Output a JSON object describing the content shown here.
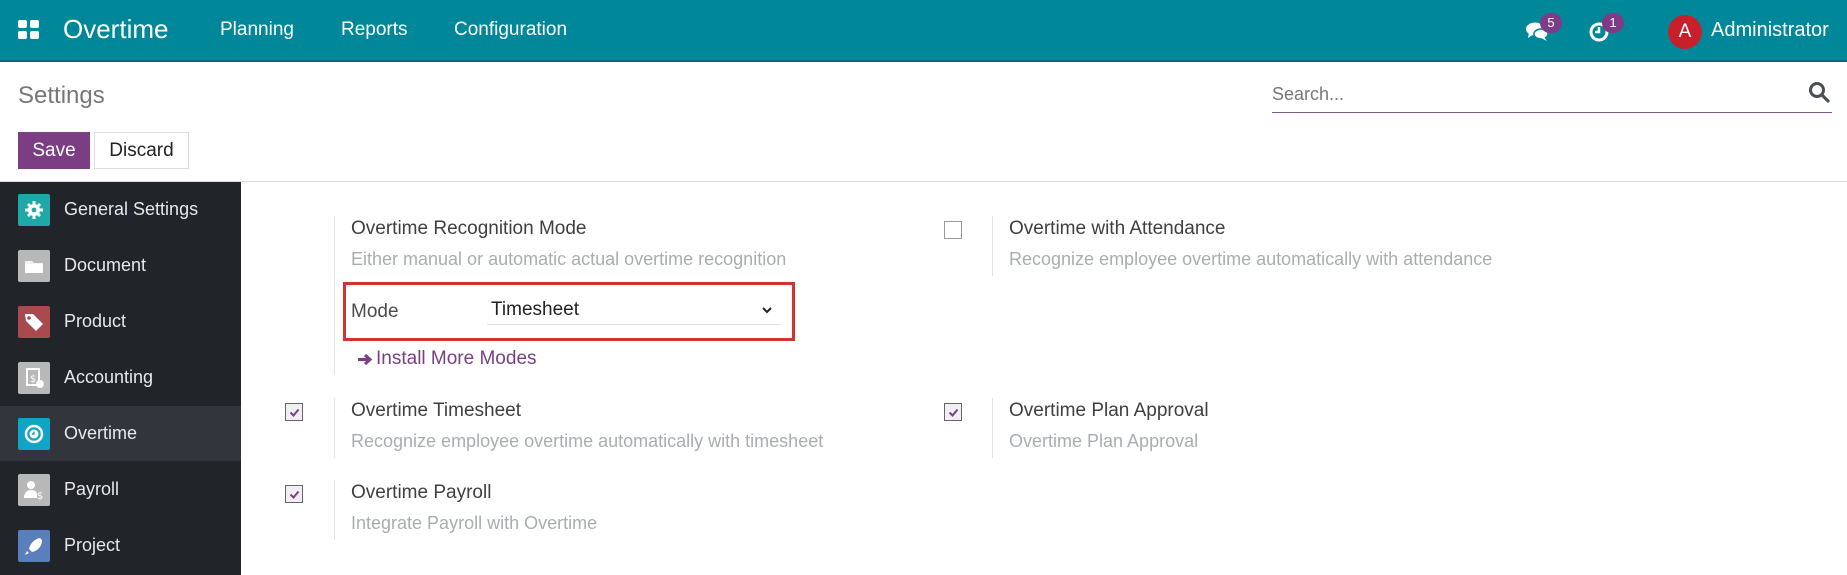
{
  "navbar": {
    "app_name": "Overtime",
    "menu": [
      {
        "label": "Planning"
      },
      {
        "label": "Reports"
      },
      {
        "label": "Configuration"
      }
    ],
    "messages_icon": "chat-bubbles-icon",
    "messages_count": "5",
    "activities_icon": "clock-icon",
    "activities_count": "1",
    "avatar_initial": "A",
    "user_name": "Administrator",
    "colors": {
      "bar": "#00879a",
      "badge": "#7c3c86",
      "avatar": "#c8202b"
    }
  },
  "control_panel": {
    "title": "Settings",
    "search_placeholder": "Search...",
    "search_value": "",
    "save_label": "Save",
    "discard_label": "Discard",
    "save_color": "#7c3e83"
  },
  "sidebar": {
    "items": [
      {
        "label": "General Settings",
        "icon": "gear-icon",
        "active": false
      },
      {
        "label": "Document",
        "icon": "folder-icon",
        "active": false
      },
      {
        "label": "Product",
        "icon": "tags-icon",
        "active": false
      },
      {
        "label": "Accounting",
        "icon": "invoice-dollar-icon",
        "active": false
      },
      {
        "label": "Overtime",
        "icon": "clock-icon",
        "active": true
      },
      {
        "label": "Payroll",
        "icon": "user-dollar-icon",
        "active": false
      },
      {
        "label": "Project",
        "icon": "rocket-icon",
        "active": false
      }
    ]
  },
  "settings": {
    "recognition_mode": {
      "title": "Overtime Recognition Mode",
      "description": "Either manual or automatic actual overtime recognition",
      "field_label": "Mode",
      "field_value": "Timesheet",
      "install_link": "Install More Modes"
    },
    "attendance": {
      "title": "Overtime with Attendance",
      "description": "Recognize employee overtime automatically with attendance",
      "checked": false
    },
    "timesheet": {
      "title": "Overtime Timesheet",
      "description": "Recognize employee overtime automatically with timesheet",
      "checked": true
    },
    "plan_approval": {
      "title": "Overtime Plan Approval",
      "description": "Overtime Plan Approval",
      "checked": true
    },
    "payroll": {
      "title": "Overtime Payroll",
      "description": "Integrate Payroll with Overtime",
      "checked": true
    }
  }
}
